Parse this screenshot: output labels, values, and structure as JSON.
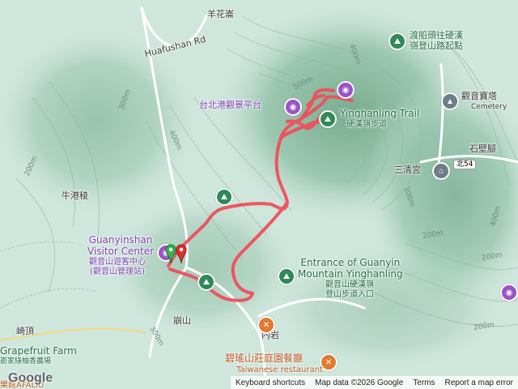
{
  "roads": {
    "huafushan": "Huafushan Rd",
    "bei54": "北54"
  },
  "places": {
    "yanghuaqi": "羊花崙",
    "niugangleng": "牛港稜",
    "shibijiao": "石壁腳",
    "sanqinggong": "三清宮",
    "qiding": "崎頂",
    "jianshan": "崩山",
    "neiyan": "內岩",
    "guanyin_pagoda": "觀音寶塔",
    "cemetery": "Cemetery",
    "grapefruit_farm": "Grapefruit Farm",
    "grapefruit_farm_zh": "嵛家綠柚香農場",
    "partial_bottom_left": "樂館AFALIU"
  },
  "pois": {
    "ferry_trailhead": "渡船頭往硬漢\n嶺登山路起點",
    "taipei_port_platform": "台北港觀景平台",
    "yinghanling_trail_en": "Yinghanling Trail",
    "yinghanling_trail_zh": "硬漢嶺步道",
    "visitor_center_en": "Guanyinshan\nVisitor Center",
    "visitor_center_zh": "觀音山遊客中心\n(觀音山管理站)",
    "entrance_en": "Entrance of Guanyin\nMountain Yinghanling",
    "entrance_zh": "觀音山硬漢嶺\n登山步道入口",
    "restaurant_zh": "碧瑤山莊庭園餐廳",
    "restaurant_en": "Taiwanese restaurant"
  },
  "contours": [
    "500m",
    "400m",
    "300m",
    "400m",
    "200m",
    "200m",
    "300m",
    "200m",
    "400m",
    "300m",
    "200m"
  ],
  "attribution": {
    "shortcuts": "Keyboard shortcuts",
    "map_data": "Map data ©2026 Google",
    "terms": "Terms",
    "report": "Report a map error"
  },
  "logo": "Google",
  "icons": {
    "hiking": "hiking-trail-icon",
    "viewpoint": "camera-viewpoint-icon",
    "restaurant": "fork-knife-icon",
    "temple": "temple-icon",
    "pagoda": "pagoda-icon"
  },
  "colors": {
    "track": "#ef4f5d",
    "forest": "#b9dcc9",
    "ridge": "#5e9b7c"
  }
}
